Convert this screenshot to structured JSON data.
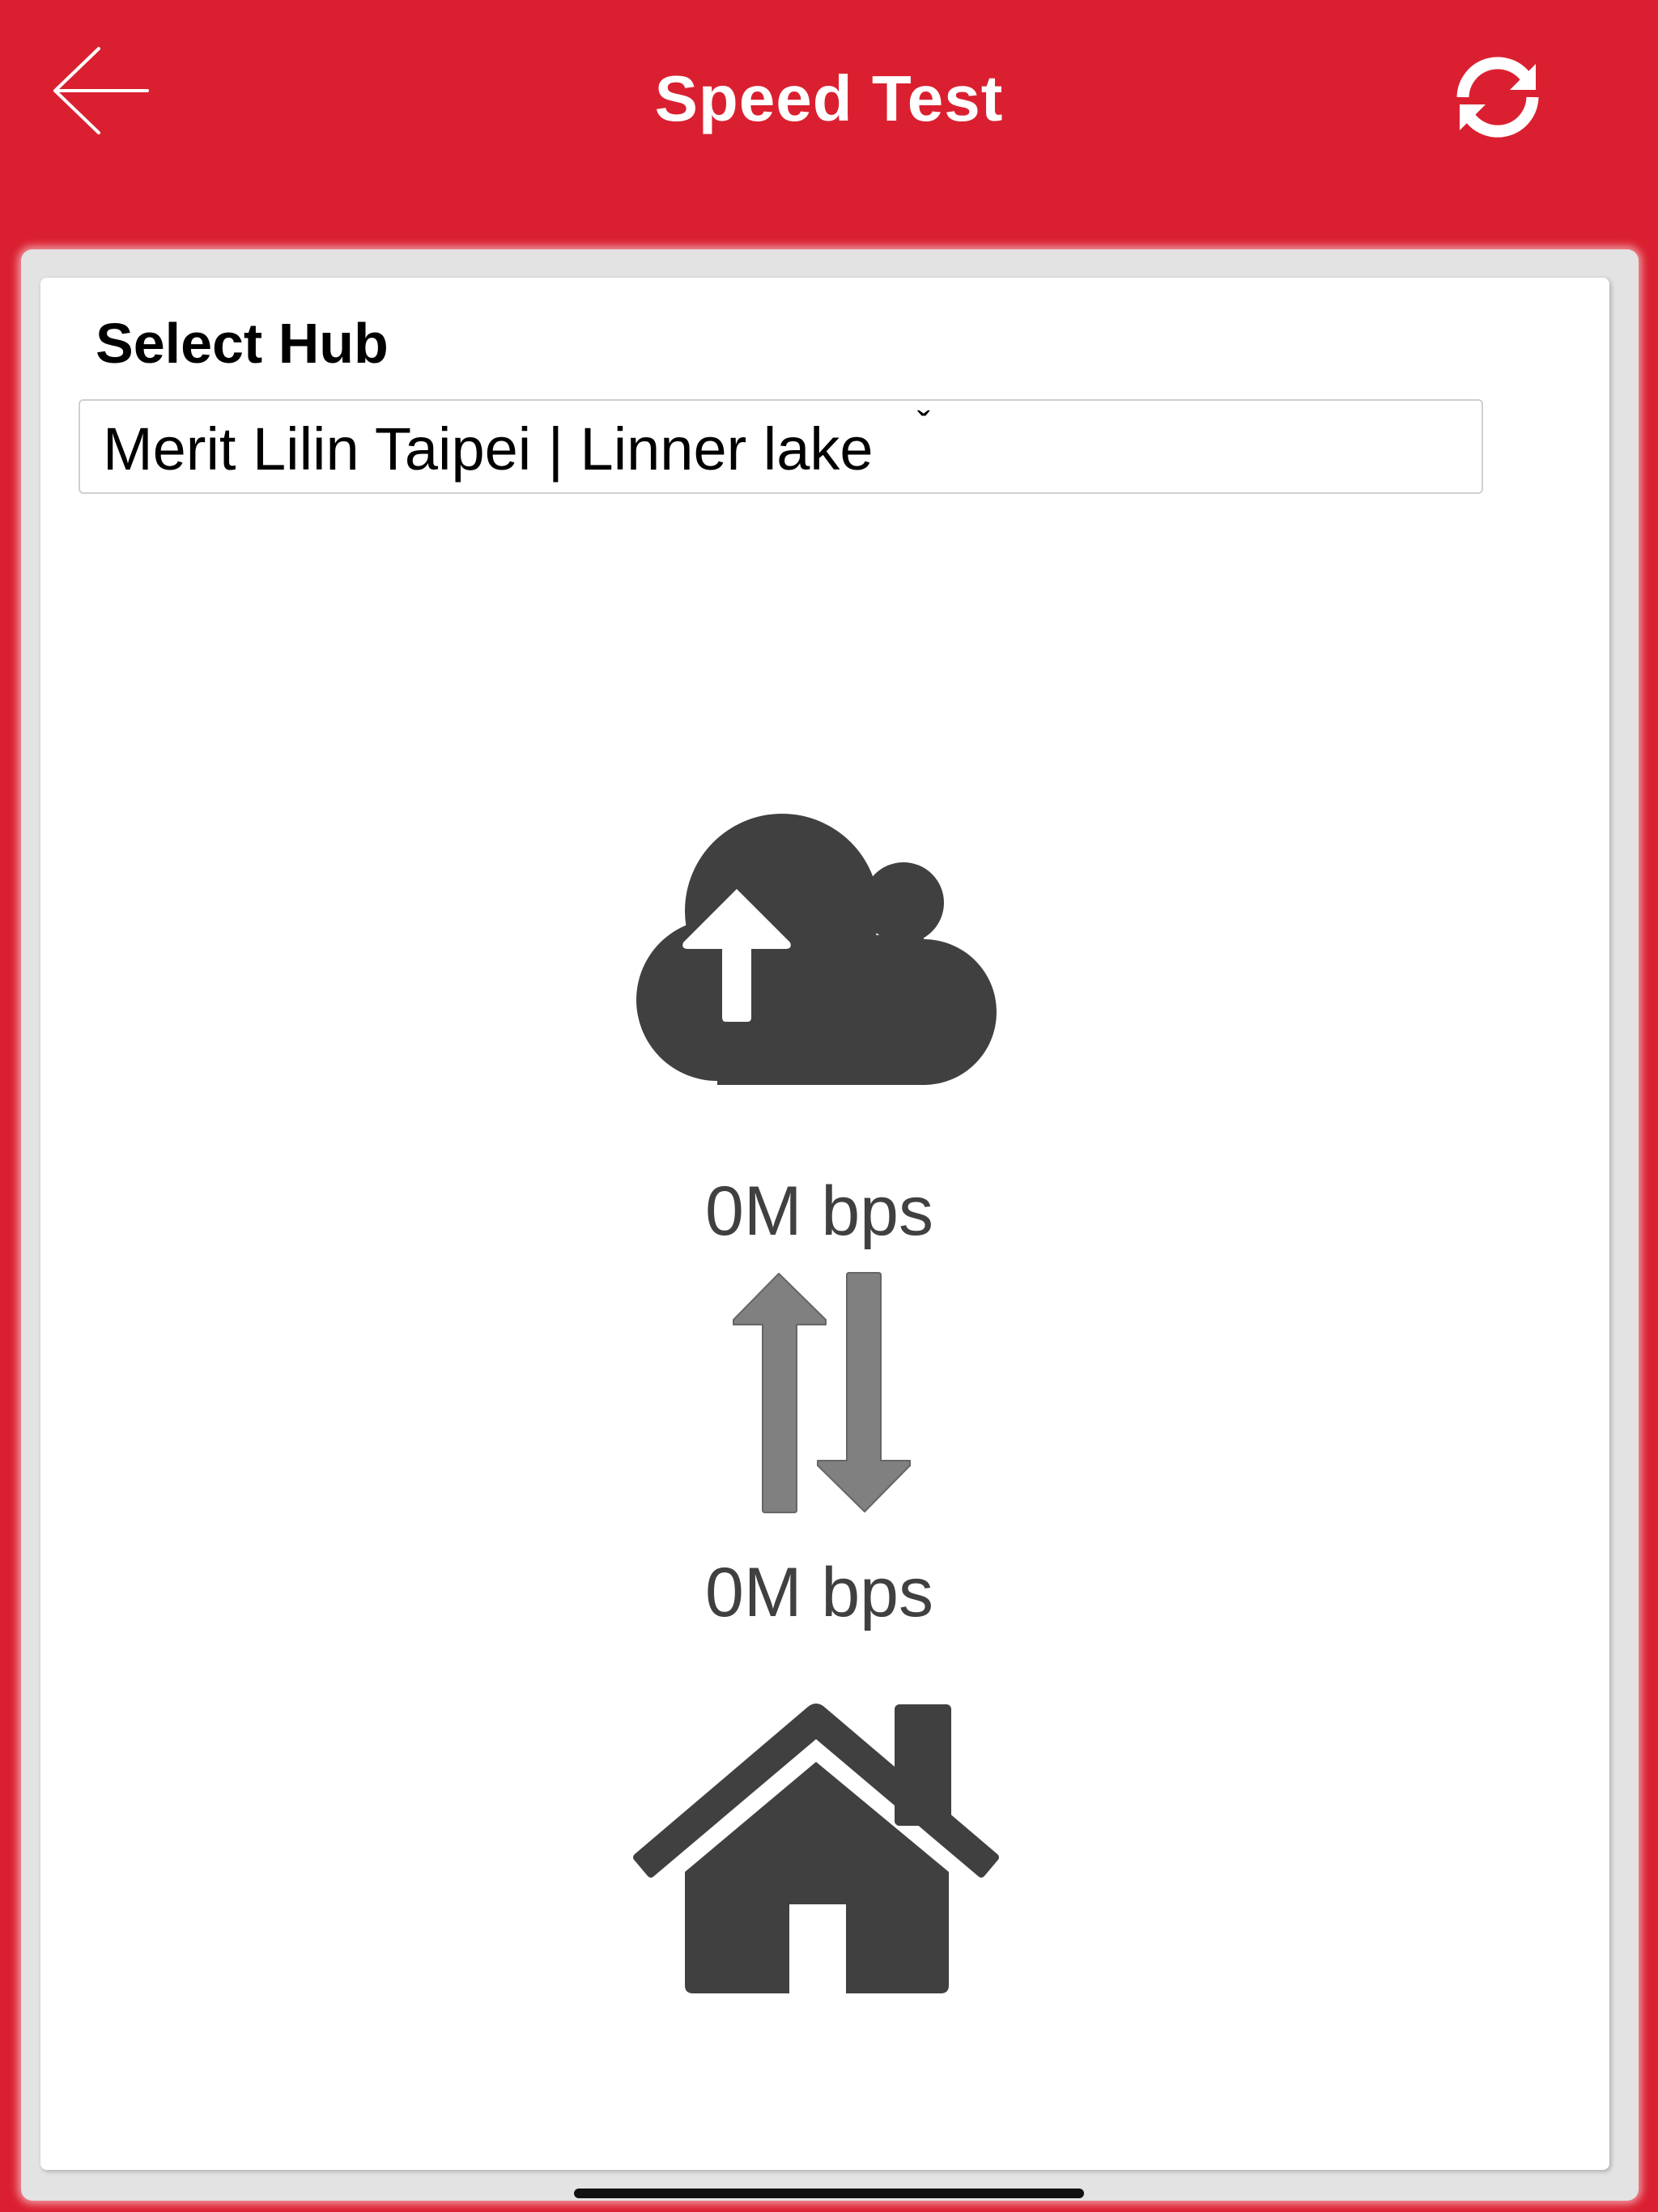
{
  "header": {
    "title": "Speed Test",
    "back_icon": "arrow-left-icon",
    "refresh_icon": "refresh-icon",
    "background_color": "#da2030"
  },
  "hub": {
    "label": "Select Hub",
    "selected_value": "Merit Lilin Taipei | Linner lake",
    "caret_glyph": "ˇ"
  },
  "results": {
    "cloud_icon": "cloud-upload-icon",
    "upload_speed": "0M bps",
    "transfer_icon": "up-down-arrows-icon",
    "download_speed": "0M bps",
    "home_icon": "home-icon"
  },
  "colors": {
    "accent": "#da2030",
    "icon_dark": "#404040",
    "icon_gray": "#808080"
  }
}
